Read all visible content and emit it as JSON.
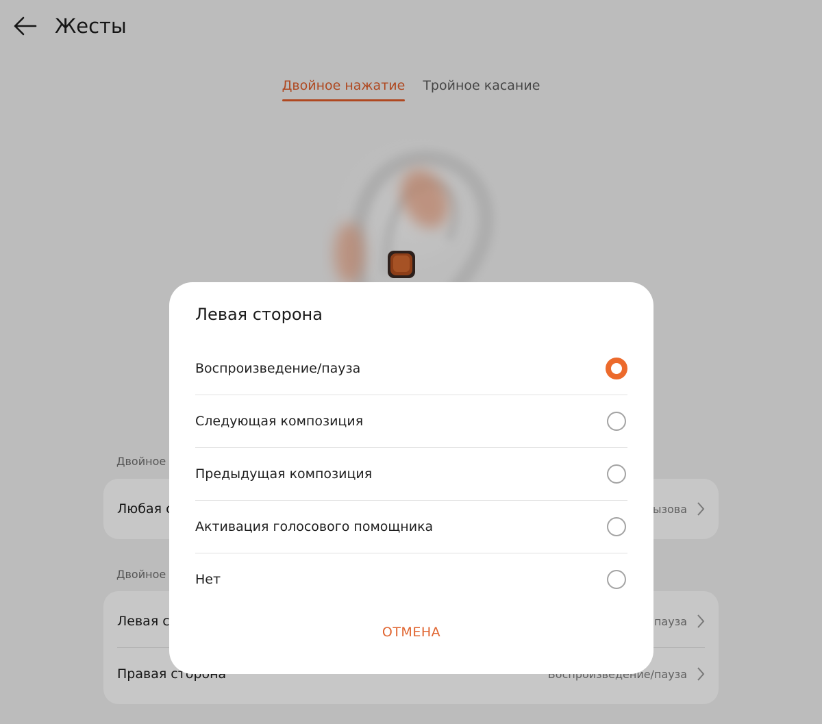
{
  "header": {
    "title": "Жесты",
    "back_icon": "arrow-left-icon"
  },
  "tabs": [
    {
      "label": "Двойное нажатие",
      "active": true
    },
    {
      "label": "Тройное касание",
      "active": false
    }
  ],
  "colors": {
    "accent": "#e05d2a",
    "radio_checked": "#ec6a2c",
    "background": "#f1f1f1",
    "dialog": "#ffffff"
  },
  "background_sections": [
    {
      "label": "Двойное",
      "rows": [
        {
          "label": "Любая с",
          "value": "ызова"
        }
      ]
    },
    {
      "label": "Двойное",
      "rows": [
        {
          "label": "Левая ст",
          "value": "пауза"
        },
        {
          "label": "Правая сторона",
          "value": "Воспроизведение/пауза"
        }
      ]
    }
  ],
  "dialog": {
    "title": "Левая сторона",
    "options": [
      {
        "label": "Воспроизведение/пауза",
        "selected": true
      },
      {
        "label": "Следующая композиция",
        "selected": false
      },
      {
        "label": "Предыдущая композиция",
        "selected": false
      },
      {
        "label": "Активация голосового помощника",
        "selected": false
      },
      {
        "label": "Нет",
        "selected": false
      }
    ],
    "cancel_label": "ОТМЕНА"
  }
}
